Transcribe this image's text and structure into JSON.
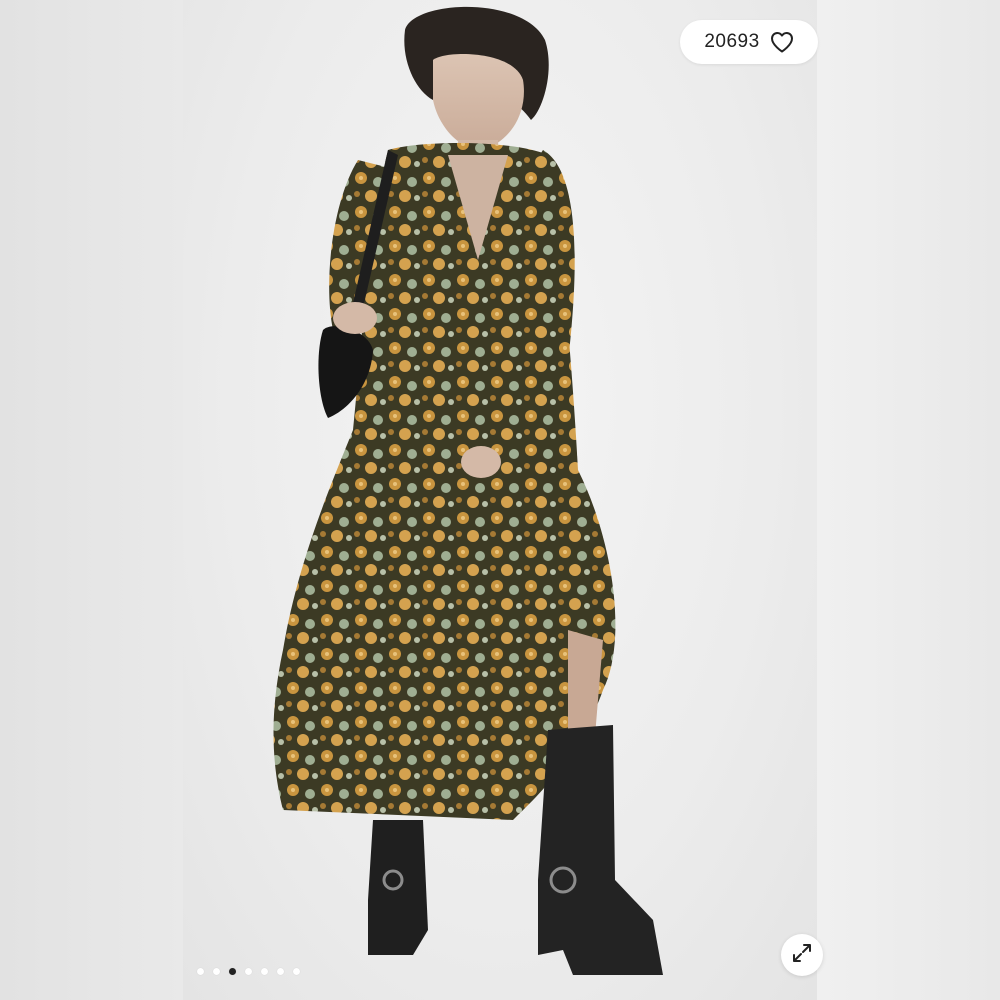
{
  "listing": {
    "likes_count": "20693",
    "like_icon": "heart-outline-icon",
    "expand_icon": "expand-arrows-icon"
  },
  "carousel": {
    "total_images": 7,
    "active_index": 2
  },
  "colors": {
    "pill_background": "#ffffff",
    "active_dot": "#222222",
    "inactive_dot": "#ffffff",
    "page_background": "#e6e6e6"
  }
}
